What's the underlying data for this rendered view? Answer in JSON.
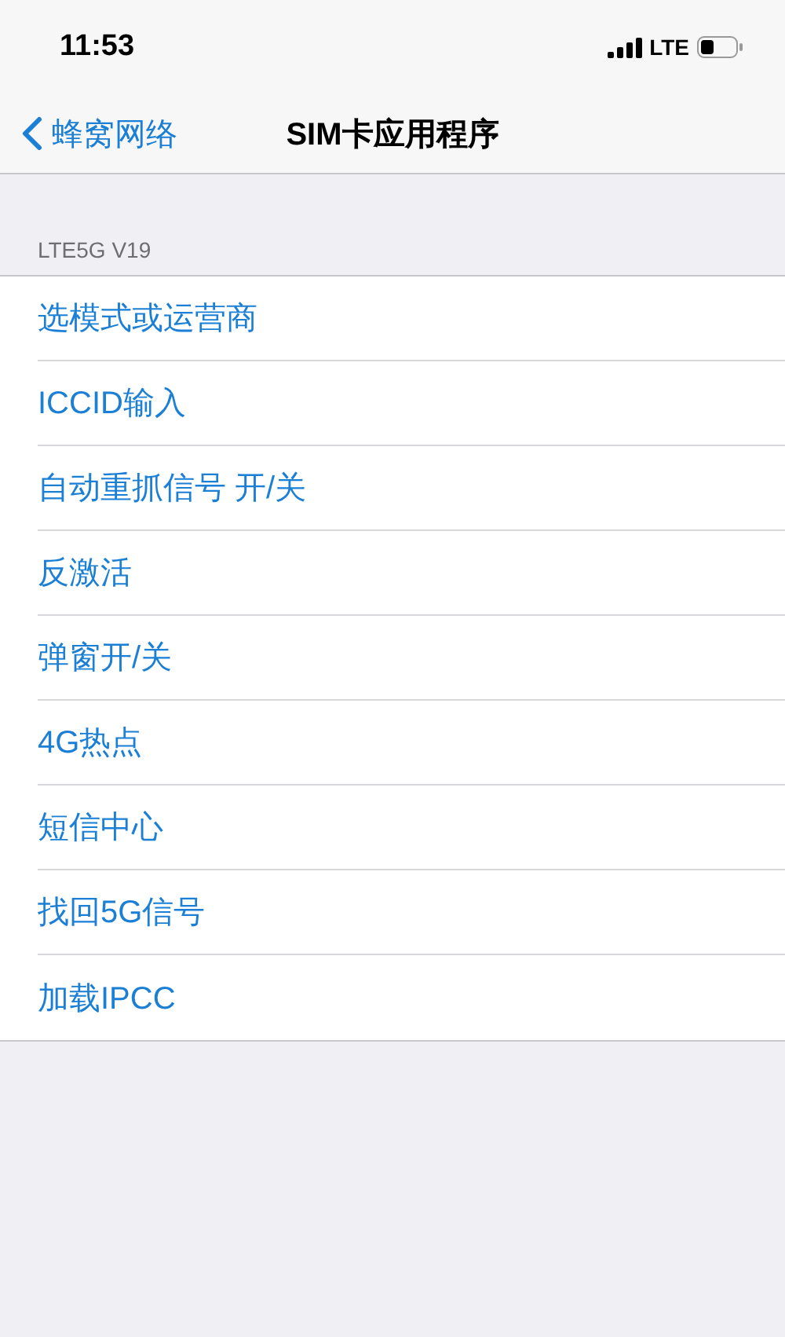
{
  "status_bar": {
    "time": "11:53",
    "network": "LTE"
  },
  "nav_bar": {
    "back": "蜂窝网络",
    "title": "SIM卡应用程序"
  },
  "section": {
    "header": "LTE5G V19",
    "items": [
      {
        "label": "选模式或运营商"
      },
      {
        "label": "ICCID输入"
      },
      {
        "label": "自动重抓信号 开/关"
      },
      {
        "label": "反激活"
      },
      {
        "label": "弹窗开/关"
      },
      {
        "label": "4G热点"
      },
      {
        "label": "短信中心"
      },
      {
        "label": "找回5G信号"
      },
      {
        "label": "加载IPCC"
      }
    ]
  }
}
